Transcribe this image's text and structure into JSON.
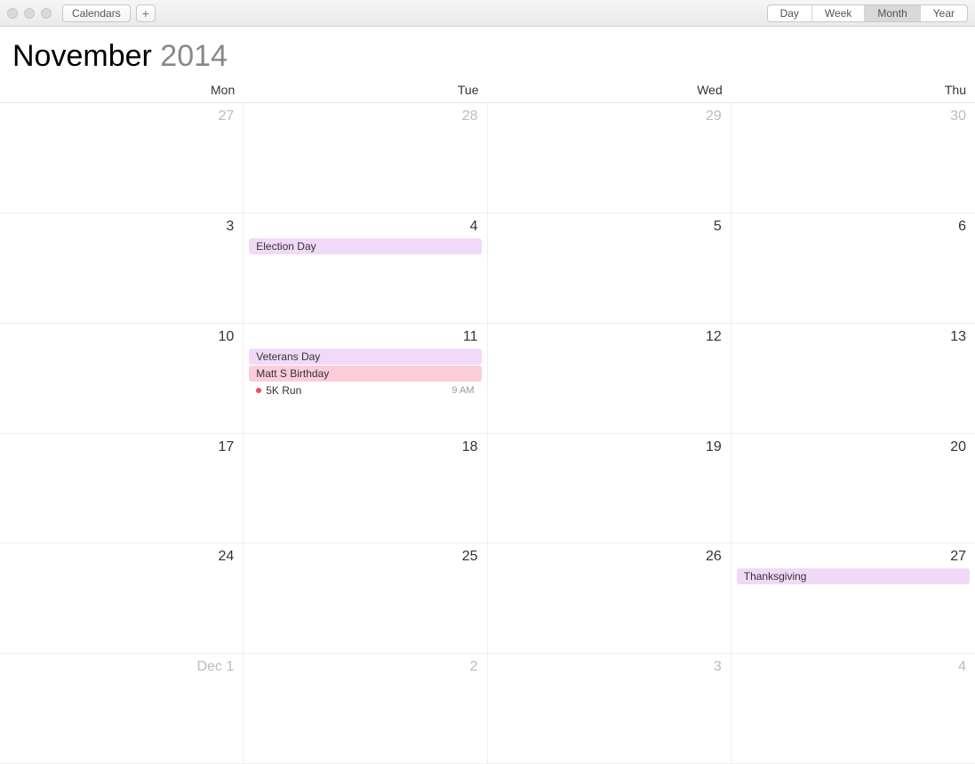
{
  "toolbar": {
    "calendars_label": "Calendars",
    "plus_label": "+",
    "views": {
      "day": "Day",
      "week": "Week",
      "month": "Month",
      "year": "Year"
    },
    "active_view": "month"
  },
  "header": {
    "month": "November",
    "year": "2014"
  },
  "weekdays": [
    "Mon",
    "Tue",
    "Wed",
    "Thu"
  ],
  "weeks": [
    [
      {
        "label": "27",
        "dim": true,
        "events": []
      },
      {
        "label": "28",
        "dim": true,
        "events": []
      },
      {
        "label": "29",
        "dim": true,
        "events": []
      },
      {
        "label": "30",
        "dim": true,
        "events": []
      }
    ],
    [
      {
        "label": "3",
        "dim": false,
        "events": []
      },
      {
        "label": "4",
        "dim": false,
        "events": [
          {
            "title": "Election Day",
            "color": "purple"
          }
        ]
      },
      {
        "label": "5",
        "dim": false,
        "events": []
      },
      {
        "label": "6",
        "dim": false,
        "events": []
      }
    ],
    [
      {
        "label": "10",
        "dim": false,
        "events": []
      },
      {
        "label": "11",
        "dim": false,
        "events": [
          {
            "title": "Veterans Day",
            "color": "purple"
          },
          {
            "title": "Matt S Birthday",
            "color": "pink"
          },
          {
            "title": "5K Run",
            "color": "timed",
            "time": "9 AM"
          }
        ]
      },
      {
        "label": "12",
        "dim": false,
        "events": []
      },
      {
        "label": "13",
        "dim": false,
        "events": []
      }
    ],
    [
      {
        "label": "17",
        "dim": false,
        "events": []
      },
      {
        "label": "18",
        "dim": false,
        "events": []
      },
      {
        "label": "19",
        "dim": false,
        "events": []
      },
      {
        "label": "20",
        "dim": false,
        "events": []
      }
    ],
    [
      {
        "label": "24",
        "dim": false,
        "events": []
      },
      {
        "label": "25",
        "dim": false,
        "events": []
      },
      {
        "label": "26",
        "dim": false,
        "events": []
      },
      {
        "label": "27",
        "dim": false,
        "events": [
          {
            "title": "Thanksgiving",
            "color": "purple"
          }
        ]
      }
    ],
    [
      {
        "label": "Dec 1",
        "dim": true,
        "events": []
      },
      {
        "label": "2",
        "dim": true,
        "events": []
      },
      {
        "label": "3",
        "dim": true,
        "events": []
      },
      {
        "label": "4",
        "dim": true,
        "events": []
      }
    ]
  ]
}
